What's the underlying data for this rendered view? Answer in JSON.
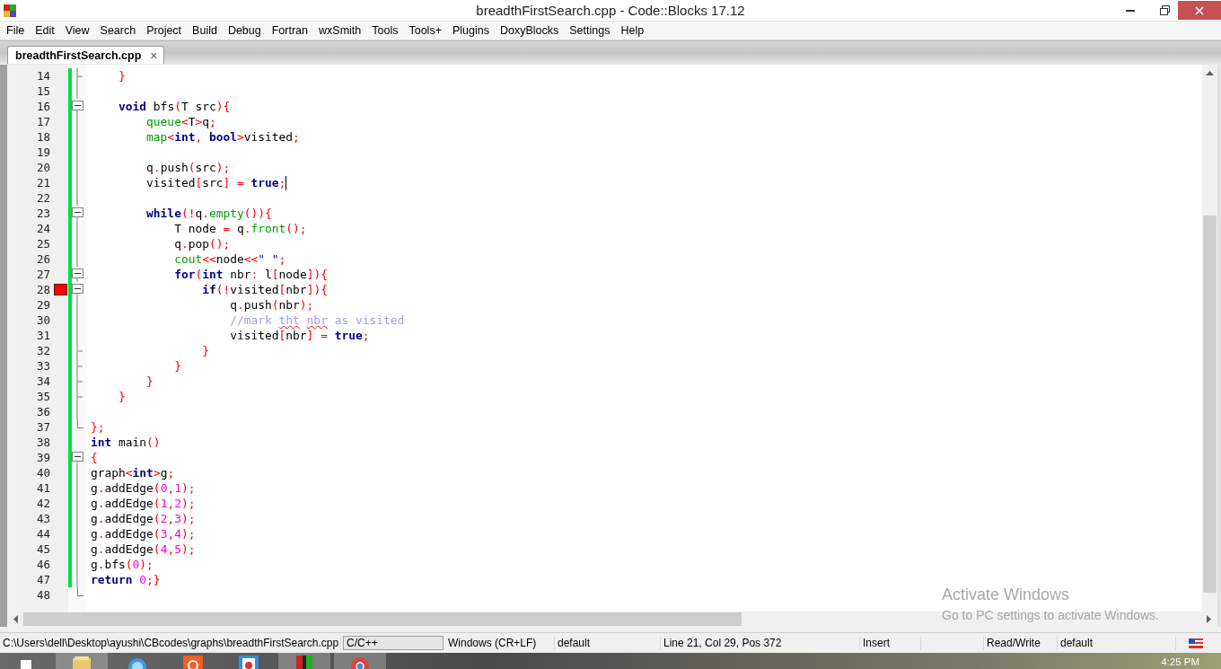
{
  "window": {
    "title": "breadthFirstSearch.cpp - Code::Blocks 17.12"
  },
  "menu": [
    "File",
    "Edit",
    "View",
    "Search",
    "Project",
    "Build",
    "Debug",
    "Fortran",
    "wxSmith",
    "Tools",
    "Tools+",
    "Plugins",
    "DoxyBlocks",
    "Settings",
    "Help"
  ],
  "tabs": [
    {
      "label": "breadthFirstSearch.cpp",
      "selected": true,
      "close": "×"
    }
  ],
  "editor": {
    "lines": [
      {
        "number": "14",
        "fold": {
          "kind": "end"
        },
        "changed": true,
        "breakpoint": false,
        "cursor": false,
        "tokens": [
          {
            "kind": "op",
            "text": "    }"
          }
        ]
      },
      {
        "number": "15",
        "fold": {
          "kind": "line"
        },
        "changed": true,
        "breakpoint": false,
        "cursor": false
      },
      {
        "number": "16",
        "fold": {
          "kind": "box"
        },
        "changed": true,
        "breakpoint": false,
        "cursor": false,
        "tokens": [
          {
            "kind": "kw",
            "text": "    void"
          },
          {
            "kind": "tx",
            "text": " bfs"
          },
          {
            "kind": "op",
            "text": "("
          },
          {
            "kind": "tx",
            "text": "T src"
          },
          {
            "kind": "op",
            "text": "){"
          }
        ]
      },
      {
        "number": "17",
        "fold": {
          "kind": "line"
        },
        "changed": true,
        "breakpoint": false,
        "cursor": false,
        "tokens": [
          {
            "kind": "fn",
            "text": "        queue"
          },
          {
            "kind": "op",
            "text": "<"
          },
          {
            "kind": "tx",
            "text": "T"
          },
          {
            "kind": "op",
            "text": ">"
          },
          {
            "kind": "tx",
            "text": "q"
          },
          {
            "kind": "op",
            "text": ";"
          }
        ]
      },
      {
        "number": "18",
        "fold": {
          "kind": "line"
        },
        "changed": true,
        "breakpoint": false,
        "cursor": false,
        "tokens": [
          {
            "kind": "fn",
            "text": "        map"
          },
          {
            "kind": "op",
            "text": "<"
          },
          {
            "kind": "kw",
            "text": "int"
          },
          {
            "kind": "op",
            "text": ", "
          },
          {
            "kind": "kw",
            "text": "bool"
          },
          {
            "kind": "op",
            "text": ">"
          },
          {
            "kind": "tx",
            "text": "visited"
          },
          {
            "kind": "op",
            "text": ";"
          }
        ]
      },
      {
        "number": "19",
        "fold": {
          "kind": "line"
        },
        "changed": true,
        "breakpoint": false,
        "cursor": false
      },
      {
        "number": "20",
        "fold": {
          "kind": "line"
        },
        "changed": true,
        "breakpoint": false,
        "cursor": false,
        "tokens": [
          {
            "kind": "tx",
            "text": "        q"
          },
          {
            "kind": "op",
            "text": "."
          },
          {
            "kind": "tx",
            "text": "push"
          },
          {
            "kind": "op",
            "text": "("
          },
          {
            "kind": "tx",
            "text": "src"
          },
          {
            "kind": "op",
            "text": ");"
          }
        ]
      },
      {
        "number": "21",
        "fold": {
          "kind": "line"
        },
        "changed": true,
        "breakpoint": false,
        "cursor": true,
        "tokens": [
          {
            "kind": "tx",
            "text": "        visited"
          },
          {
            "kind": "op",
            "text": "["
          },
          {
            "kind": "tx",
            "text": "src"
          },
          {
            "kind": "op",
            "text": "] = "
          },
          {
            "kind": "kw",
            "text": "true"
          },
          {
            "kind": "op",
            "text": ";"
          }
        ]
      },
      {
        "number": "22",
        "fold": {
          "kind": "line"
        },
        "changed": true,
        "breakpoint": false,
        "cursor": false
      },
      {
        "number": "23",
        "fold": {
          "kind": "box"
        },
        "changed": true,
        "breakpoint": false,
        "cursor": false,
        "tokens": [
          {
            "kind": "kw",
            "text": "        while"
          },
          {
            "kind": "op",
            "text": "(!"
          },
          {
            "kind": "tx",
            "text": "q"
          },
          {
            "kind": "op",
            "text": "."
          },
          {
            "kind": "fn",
            "text": "empty"
          },
          {
            "kind": "op",
            "text": "()){"
          }
        ]
      },
      {
        "number": "24",
        "fold": {
          "kind": "line"
        },
        "changed": true,
        "breakpoint": false,
        "cursor": false,
        "tokens": [
          {
            "kind": "tx",
            "text": "            T node "
          },
          {
            "kind": "op",
            "text": "="
          },
          {
            "kind": "tx",
            "text": " q"
          },
          {
            "kind": "op",
            "text": "."
          },
          {
            "kind": "fn",
            "text": "front"
          },
          {
            "kind": "op",
            "text": "();"
          }
        ]
      },
      {
        "number": "25",
        "fold": {
          "kind": "line"
        },
        "changed": true,
        "breakpoint": false,
        "cursor": false,
        "tokens": [
          {
            "kind": "tx",
            "text": "            q"
          },
          {
            "kind": "op",
            "text": "."
          },
          {
            "kind": "tx",
            "text": "pop"
          },
          {
            "kind": "op",
            "text": "();"
          }
        ]
      },
      {
        "number": "26",
        "fold": {
          "kind": "line"
        },
        "changed": true,
        "breakpoint": false,
        "cursor": false,
        "tokens": [
          {
            "kind": "fn",
            "text": "            cout"
          },
          {
            "kind": "op",
            "text": "<<"
          },
          {
            "kind": "tx",
            "text": "node"
          },
          {
            "kind": "op",
            "text": "<<"
          },
          {
            "kind": "st",
            "text": "\" \""
          },
          {
            "kind": "op",
            "text": ";"
          }
        ]
      },
      {
        "number": "27",
        "fold": {
          "kind": "box"
        },
        "changed": true,
        "breakpoint": false,
        "cursor": false,
        "tokens": [
          {
            "kind": "kw",
            "text": "            for"
          },
          {
            "kind": "op",
            "text": "("
          },
          {
            "kind": "kw",
            "text": "int"
          },
          {
            "kind": "tx",
            "text": " nbr"
          },
          {
            "kind": "op",
            "text": ":"
          },
          {
            "kind": "tx",
            "text": " l"
          },
          {
            "kind": "op",
            "text": "["
          },
          {
            "kind": "tx",
            "text": "node"
          },
          {
            "kind": "op",
            "text": "]){"
          }
        ]
      },
      {
        "number": "28",
        "fold": {
          "kind": "box"
        },
        "changed": true,
        "breakpoint": true,
        "cursor": false,
        "tokens": [
          {
            "kind": "kw",
            "text": "                if"
          },
          {
            "kind": "op",
            "text": "(!"
          },
          {
            "kind": "tx",
            "text": "visited"
          },
          {
            "kind": "op",
            "text": "["
          },
          {
            "kind": "tx",
            "text": "nbr"
          },
          {
            "kind": "op",
            "text": "]){"
          }
        ]
      },
      {
        "number": "29",
        "fold": {
          "kind": "line"
        },
        "changed": true,
        "breakpoint": false,
        "cursor": false,
        "tokens": [
          {
            "kind": "tx",
            "text": "                    q"
          },
          {
            "kind": "op",
            "text": "."
          },
          {
            "kind": "tx",
            "text": "push"
          },
          {
            "kind": "op",
            "text": "("
          },
          {
            "kind": "tx",
            "text": "nbr"
          },
          {
            "kind": "op",
            "text": ");"
          }
        ]
      },
      {
        "number": "30",
        "fold": {
          "kind": "line"
        },
        "changed": true,
        "breakpoint": false,
        "cursor": false,
        "tokens": [
          {
            "kind": "cm",
            "text": "                    //mark "
          },
          {
            "kind": "sp",
            "text": "tht"
          },
          {
            "kind": "sp",
            "text": " nbr"
          },
          {
            "kind": "cm",
            "text": " as visited"
          }
        ]
      },
      {
        "number": "31",
        "fold": {
          "kind": "line"
        },
        "changed": true,
        "breakpoint": false,
        "cursor": false,
        "tokens": [
          {
            "kind": "tx",
            "text": "                    visited"
          },
          {
            "kind": "op",
            "text": "["
          },
          {
            "kind": "tx",
            "text": "nbr"
          },
          {
            "kind": "op",
            "text": "] = "
          },
          {
            "kind": "kw",
            "text": "true"
          },
          {
            "kind": "op",
            "text": ";"
          }
        ]
      },
      {
        "number": "32",
        "fold": {
          "kind": "end"
        },
        "changed": true,
        "breakpoint": false,
        "cursor": false,
        "tokens": [
          {
            "kind": "op",
            "text": "                }"
          }
        ]
      },
      {
        "number": "33",
        "fold": {
          "kind": "end"
        },
        "changed": true,
        "breakpoint": false,
        "cursor": false,
        "tokens": [
          {
            "kind": "op",
            "text": "            }"
          }
        ]
      },
      {
        "number": "34",
        "fold": {
          "kind": "end"
        },
        "changed": true,
        "breakpoint": false,
        "cursor": false,
        "tokens": [
          {
            "kind": "op",
            "text": "        }"
          }
        ]
      },
      {
        "number": "35",
        "fold": {
          "kind": "end"
        },
        "changed": true,
        "breakpoint": false,
        "cursor": false,
        "tokens": [
          {
            "kind": "op",
            "text": "    }"
          }
        ]
      },
      {
        "number": "36",
        "fold": {
          "kind": "line"
        },
        "changed": true,
        "breakpoint": false,
        "cursor": false
      },
      {
        "number": "37",
        "fold": {
          "kind": "corner"
        },
        "changed": true,
        "breakpoint": false,
        "cursor": false,
        "tokens": [
          {
            "kind": "op",
            "text": "};"
          }
        ]
      },
      {
        "number": "38",
        "changed": true,
        "breakpoint": false,
        "cursor": false,
        "tokens": [
          {
            "kind": "kw",
            "text": "int"
          },
          {
            "kind": "tx",
            "text": " main"
          },
          {
            "kind": "op",
            "text": "()"
          }
        ]
      },
      {
        "number": "39",
        "fold": {
          "kind": "box"
        },
        "changed": true,
        "breakpoint": false,
        "cursor": false,
        "tokens": [
          {
            "kind": "op",
            "text": "{"
          }
        ]
      },
      {
        "number": "40",
        "fold": {
          "kind": "line"
        },
        "changed": true,
        "breakpoint": false,
        "cursor": false,
        "tokens": [
          {
            "kind": "tx",
            "text": "graph"
          },
          {
            "kind": "op",
            "text": "<"
          },
          {
            "kind": "kw",
            "text": "int"
          },
          {
            "kind": "op",
            "text": ">"
          },
          {
            "kind": "tx",
            "text": "g"
          },
          {
            "kind": "op",
            "text": ";"
          }
        ]
      },
      {
        "number": "41",
        "fold": {
          "kind": "line"
        },
        "changed": true,
        "breakpoint": false,
        "cursor": false,
        "tokens": [
          {
            "kind": "tx",
            "text": "g"
          },
          {
            "kind": "op",
            "text": "."
          },
          {
            "kind": "tx",
            "text": "addEdge"
          },
          {
            "kind": "op",
            "text": "("
          },
          {
            "kind": "nm",
            "text": "0"
          },
          {
            "kind": "op",
            "text": ","
          },
          {
            "kind": "nm",
            "text": "1"
          },
          {
            "kind": "op",
            "text": ");"
          }
        ]
      },
      {
        "number": "42",
        "fold": {
          "kind": "line"
        },
        "changed": true,
        "breakpoint": false,
        "cursor": false,
        "tokens": [
          {
            "kind": "tx",
            "text": "g"
          },
          {
            "kind": "op",
            "text": "."
          },
          {
            "kind": "tx",
            "text": "addEdge"
          },
          {
            "kind": "op",
            "text": "("
          },
          {
            "kind": "nm",
            "text": "1"
          },
          {
            "kind": "op",
            "text": ","
          },
          {
            "kind": "nm",
            "text": "2"
          },
          {
            "kind": "op",
            "text": ");"
          }
        ]
      },
      {
        "number": "43",
        "fold": {
          "kind": "line"
        },
        "changed": true,
        "breakpoint": false,
        "cursor": false,
        "tokens": [
          {
            "kind": "tx",
            "text": "g"
          },
          {
            "kind": "op",
            "text": "."
          },
          {
            "kind": "tx",
            "text": "addEdge"
          },
          {
            "kind": "op",
            "text": "("
          },
          {
            "kind": "nm",
            "text": "2"
          },
          {
            "kind": "op",
            "text": ","
          },
          {
            "kind": "nm",
            "text": "3"
          },
          {
            "kind": "op",
            "text": ");"
          }
        ]
      },
      {
        "number": "44",
        "fold": {
          "kind": "line"
        },
        "changed": true,
        "breakpoint": false,
        "cursor": false,
        "tokens": [
          {
            "kind": "tx",
            "text": "g"
          },
          {
            "kind": "op",
            "text": "."
          },
          {
            "kind": "tx",
            "text": "addEdge"
          },
          {
            "kind": "op",
            "text": "("
          },
          {
            "kind": "nm",
            "text": "3"
          },
          {
            "kind": "op",
            "text": ","
          },
          {
            "kind": "nm",
            "text": "4"
          },
          {
            "kind": "op",
            "text": ");"
          }
        ]
      },
      {
        "number": "45",
        "fold": {
          "kind": "line"
        },
        "changed": true,
        "breakpoint": false,
        "cursor": false,
        "tokens": [
          {
            "kind": "tx",
            "text": "g"
          },
          {
            "kind": "op",
            "text": "."
          },
          {
            "kind": "tx",
            "text": "addEdge"
          },
          {
            "kind": "op",
            "text": "("
          },
          {
            "kind": "nm",
            "text": "4"
          },
          {
            "kind": "op",
            "text": ","
          },
          {
            "kind": "nm",
            "text": "5"
          },
          {
            "kind": "op",
            "text": ");"
          }
        ]
      },
      {
        "number": "46",
        "fold": {
          "kind": "line"
        },
        "changed": true,
        "breakpoint": false,
        "cursor": false,
        "tokens": [
          {
            "kind": "tx",
            "text": "g"
          },
          {
            "kind": "op",
            "text": "."
          },
          {
            "kind": "tx",
            "text": "bfs"
          },
          {
            "kind": "op",
            "text": "("
          },
          {
            "kind": "nm",
            "text": "0"
          },
          {
            "kind": "op",
            "text": ");"
          }
        ]
      },
      {
        "number": "47",
        "fold": {
          "kind": "line"
        },
        "changed": true,
        "breakpoint": false,
        "cursor": false,
        "tokens": [
          {
            "kind": "kw",
            "text": "return"
          },
          {
            "kind": "nm",
            "text": " 0"
          },
          {
            "kind": "op",
            "text": ";}"
          }
        ]
      },
      {
        "number": "48",
        "fold": {
          "kind": "corner"
        },
        "changed": false,
        "breakpoint": false,
        "cursor": false
      }
    ]
  },
  "activation_notice": {
    "title": "Activate Windows",
    "message": "Go to PC settings to activate Windows."
  },
  "status_bar": [
    {
      "text": "C:\\Users\\dell\\Desktop\\ayushi\\CBcodes\\graphs\\breadthFirstSearch.cpp",
      "kind": "plain"
    },
    {
      "text": "C/C++",
      "kind": "sunken"
    },
    {
      "text": "Windows (CR+LF)",
      "kind": "plain"
    },
    {
      "text": "default",
      "kind": "plain"
    },
    {
      "text": "Line 21, Col 29, Pos 372",
      "kind": "plain"
    },
    {
      "text": "Insert",
      "kind": "plain"
    },
    {
      "kind": "plain"
    },
    {
      "text": "Read/Write",
      "kind": "plain"
    },
    {
      "text": "default",
      "kind": "plain"
    },
    {
      "kind": "flag"
    }
  ],
  "taskbar": {
    "apps": [
      {
        "kind": "start"
      },
      {
        "kind": "folder"
      },
      {
        "kind": "browser"
      },
      {
        "kind": "orange"
      },
      {
        "kind": "film"
      },
      {
        "kind": "codeblocks"
      },
      {
        "kind": "chrome"
      }
    ],
    "clock": "4:25 PM"
  }
}
